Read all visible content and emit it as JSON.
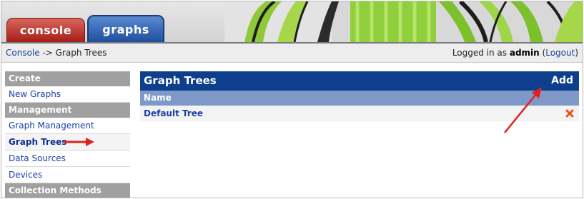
{
  "tabs": [
    {
      "label": "console",
      "active": false
    },
    {
      "label": "graphs",
      "active": true
    }
  ],
  "navbar": {
    "breadcrumb_link": "Console",
    "breadcrumb_sep": " -> ",
    "breadcrumb_current": "Graph Trees",
    "login_prefix": "Logged in as ",
    "login_user": "admin",
    "logout_label": "Logout"
  },
  "sidebar": {
    "sections": [
      {
        "heading": "Create",
        "items": [
          "New Graphs"
        ]
      },
      {
        "heading": "Management",
        "items": [
          "Graph Management",
          "Graph Trees",
          "Data Sources",
          "Devices"
        ]
      },
      {
        "heading": "Collection Methods",
        "items": []
      }
    ],
    "active_item": "Graph Trees"
  },
  "main": {
    "title": "Graph Trees",
    "add_label": "Add",
    "columns": [
      "Name"
    ],
    "rows": [
      {
        "name": "Default Tree"
      }
    ]
  },
  "colors": {
    "console_tab": "#b3261e",
    "graphs_tab": "#2a5db0",
    "table_header": "#0d3f8c",
    "column_header": "#7e99c8",
    "annotation_arrow": "#e0201a",
    "delete_icon": "#e8541c"
  },
  "icons": [
    "delete-x-icon",
    "annotation-arrow-icon"
  ]
}
